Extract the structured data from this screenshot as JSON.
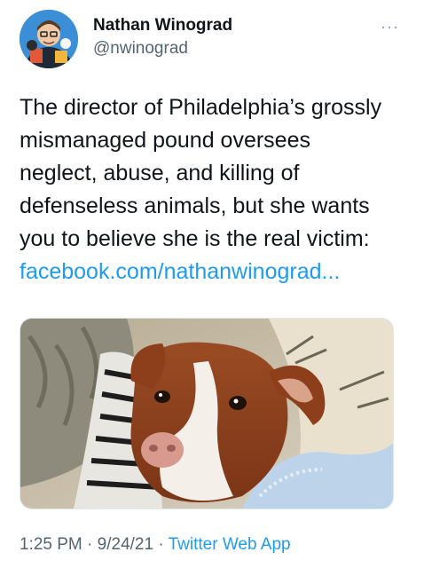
{
  "author": {
    "display_name": "Nathan Winograd",
    "handle": "@nwinograd"
  },
  "more_icon": "more-dots-icon",
  "tweet": {
    "lines": [
      "The director of Philadelphia’s grossly",
      "mismanaged pound oversees",
      "neglect, abuse, and killing of",
      "defenseless animals, but she wants",
      "you to believe she is the real victim:"
    ],
    "link": "facebook.com/nathanwinograd..."
  },
  "media": {
    "progress": 0.01,
    "progress_color": "#e0245e"
  },
  "meta": {
    "time": "1:25 PM",
    "separator": " · ",
    "date": "9/24/21",
    "source": "Twitter Web App"
  },
  "colors": {
    "link": "#1d9bf0",
    "secondary_text": "#536471"
  }
}
